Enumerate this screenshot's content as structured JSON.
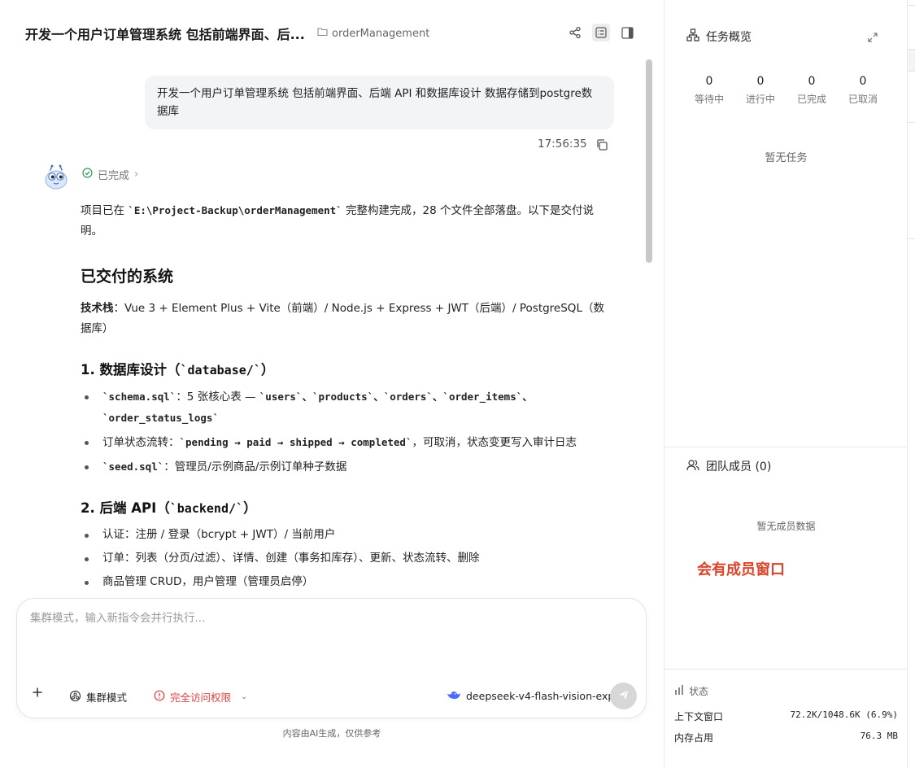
{
  "header": {
    "title": "开发一个用户订单管理系统 包括前端界面、后...",
    "folder": "orderManagement"
  },
  "user_message": {
    "text": "开发一个用户订单管理系统 包括前端界面、后端 API 和数据库设计 数据存储到postgre数据库",
    "time": "17:56:35"
  },
  "assistant": {
    "status": "已完成",
    "intro_prefix": "项目已在 ",
    "intro_path": "`E:\\Project-Backup\\orderManagement`",
    "intro_suffix": " 完整构建完成，28 个文件全部落盘。以下是交付说明。",
    "h2": "已交付的系统",
    "tech_label": "技术栈",
    "tech_text": "：Vue 3 + Element Plus + Vite（前端）/ Node.js + Express + JWT（后端）/ PostgreSQL（数据库）",
    "s1_title_prefix": "1. 数据库设计（",
    "s1_title_code": "`database/`",
    "s1_title_suffix": "）",
    "s1_item1_code": "`schema.sql`",
    "s1_item1_text": "：5 张核心表 — ",
    "s1_item1_tables": "`users`、`products`、`orders`、`order_items`、`order_status_logs`",
    "s1_item2_text": "订单状态流转：",
    "s1_item2_code": "`pending → paid → shipped → completed`",
    "s1_item2_suffix": "，可取消，状态变更写入审计日志",
    "s1_item3_code": "`seed.sql`",
    "s1_item3_text": "：管理员/示例商品/示例订单种子数据",
    "s2_title_prefix": "2. 后端 API（",
    "s2_title_code": "`backend/`",
    "s2_title_suffix": "）",
    "s2_item1": "认证：注册 / 登录（bcrypt + JWT）/ 当前用户",
    "s2_item2": "订单：列表（分页/过滤）、详情、创建（事务扣库存）、更新、状态流转、删除",
    "s2_item3": "商品管理 CRUD，用户管理（管理员启停）"
  },
  "composer": {
    "placeholder": "集群模式，输入新指令会并行执行...",
    "cluster_mode": "集群模式",
    "access": "完全访问权限",
    "model": "deepseek-v4-flash-vision-exp",
    "footer_note": "内容由AI生成，仅供参考"
  },
  "panel": {
    "task_title": "任务概览",
    "stats": [
      {
        "num": "0",
        "label": "等待中"
      },
      {
        "num": "0",
        "label": "进行中"
      },
      {
        "num": "0",
        "label": "已完成"
      },
      {
        "num": "0",
        "label": "已取消"
      }
    ],
    "no_task": "暂无任务",
    "team_title": "团队成员 (0)",
    "no_member": "暂无成员数据",
    "member_note": "会有成员窗口",
    "status_title": "状态",
    "context_label": "上下文窗口",
    "context_value": "72.2K/1048.6K (6.9%)",
    "memory_label": "内存占用",
    "memory_value": "76.3 MB"
  },
  "colors": {
    "accent_red": "#d9452b",
    "check_green": "#2e9b57",
    "warning_red": "#e03e3e",
    "model_blue": "#4d6bfe"
  }
}
